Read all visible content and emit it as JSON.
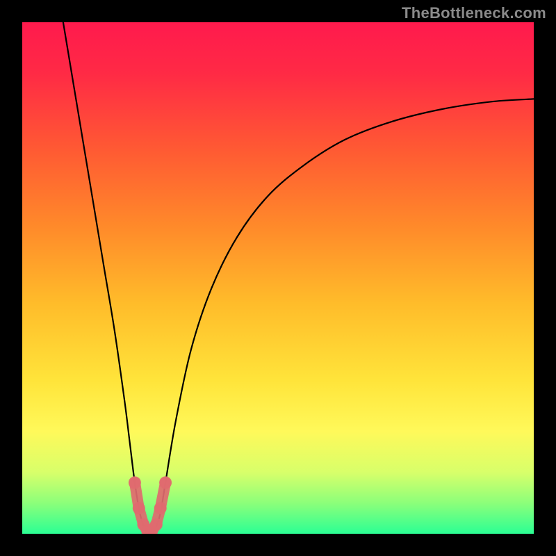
{
  "watermark": "TheBottleneck.com",
  "chart_data": {
    "type": "line",
    "title": "",
    "xlabel": "",
    "ylabel": "",
    "xlim": [
      0,
      100
    ],
    "ylim": [
      0,
      100
    ],
    "gradient_stops": [
      {
        "offset": 0.0,
        "color": "#ff1a4d"
      },
      {
        "offset": 0.1,
        "color": "#ff2a45"
      },
      {
        "offset": 0.25,
        "color": "#ff5a33"
      },
      {
        "offset": 0.4,
        "color": "#ff8a2a"
      },
      {
        "offset": 0.55,
        "color": "#ffbc2a"
      },
      {
        "offset": 0.7,
        "color": "#ffe43a"
      },
      {
        "offset": 0.8,
        "color": "#fff95a"
      },
      {
        "offset": 0.88,
        "color": "#d8ff6a"
      },
      {
        "offset": 0.94,
        "color": "#8cff7a"
      },
      {
        "offset": 1.0,
        "color": "#2bff94"
      }
    ],
    "series": [
      {
        "name": "bottleneck-curve",
        "x": [
          8,
          10,
          12,
          14,
          16,
          18,
          20,
          21,
          22,
          23,
          24,
          25,
          26,
          27,
          28,
          30,
          33,
          37,
          42,
          48,
          55,
          63,
          72,
          82,
          92,
          100
        ],
        "y": [
          100,
          88,
          76,
          64,
          52,
          40,
          26,
          18,
          10,
          4,
          1,
          0,
          1,
          4,
          10,
          22,
          36,
          48,
          58,
          66,
          72,
          77,
          80.5,
          83,
          84.5,
          85
        ]
      }
    ],
    "highlight": {
      "color": "#e06a6f",
      "points_x": [
        22.0,
        22.8,
        23.7,
        24.5,
        25.3,
        26.2,
        27.0,
        28.0
      ],
      "points_y": [
        10.0,
        5.0,
        1.8,
        0.5,
        0.5,
        1.8,
        5.0,
        10.0
      ]
    }
  }
}
